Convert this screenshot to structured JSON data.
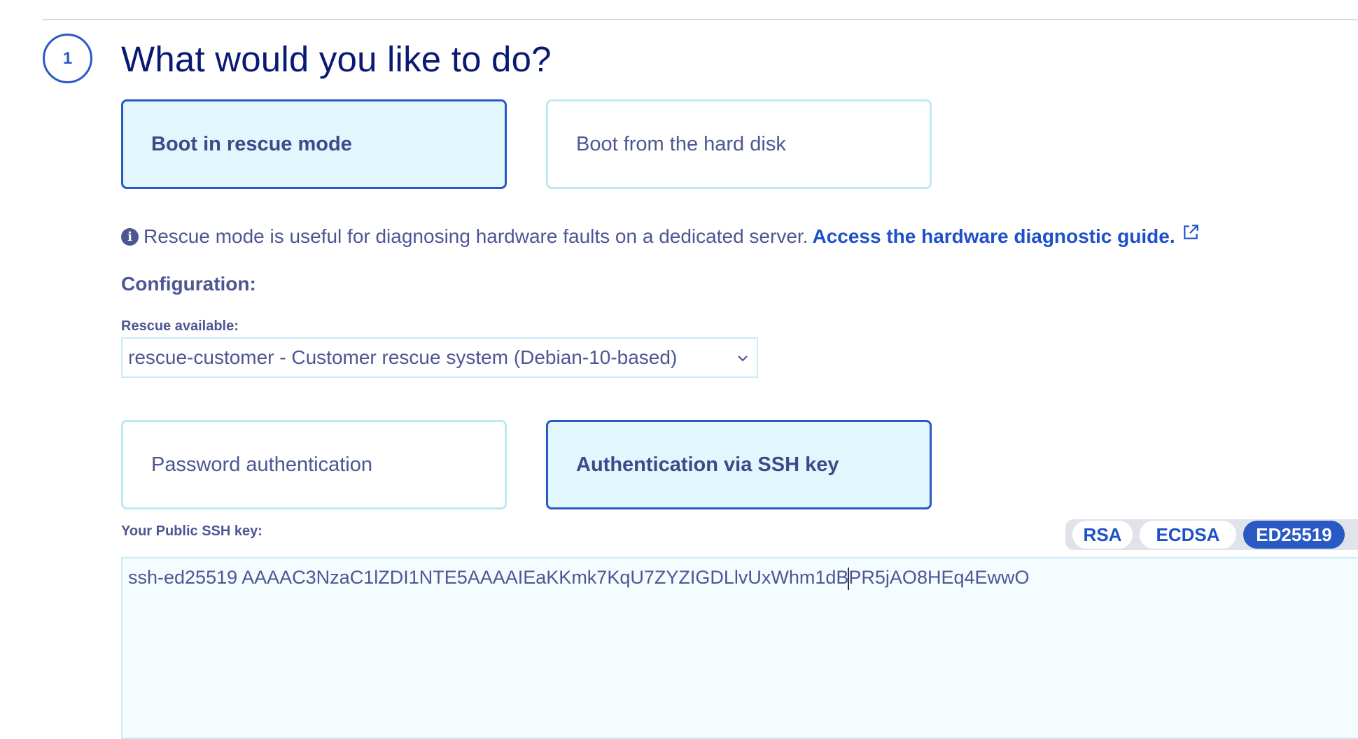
{
  "step": {
    "number": "1",
    "title": "What would you like to do?"
  },
  "boot_options": {
    "rescue": "Boot in rescue mode",
    "hard_disk": "Boot from the hard disk"
  },
  "info": {
    "text": "Rescue mode is useful for diagnosing hardware faults on a dedicated server.",
    "link": "Access the hardware diagnostic guide."
  },
  "configuration": {
    "heading": "Configuration:",
    "rescue_label": "Rescue available:",
    "rescue_value": "rescue-customer - Customer rescue system (Debian-10-based)"
  },
  "auth_options": {
    "password": "Password authentication",
    "ssh": "Authentication via SSH key"
  },
  "ssh": {
    "label": "Your Public SSH key:",
    "types": [
      "RSA",
      "ECDSA",
      "ED25519"
    ],
    "selected_type": "ED25519",
    "key_before_cursor": "ssh-ed25519 AAAAC3NzaC1lZDI1NTE5AAAAIEaKKmk7KqU7ZYZIGDLlvUxWhm1dB",
    "key_after_cursor": "PR5jAO8HEq4EwwO"
  },
  "colors": {
    "accent": "#2859c5",
    "selected_bg": "#e2f6fd",
    "tile_border": "#bde9f5",
    "text": "#4d5693",
    "link": "#1e50c8"
  }
}
